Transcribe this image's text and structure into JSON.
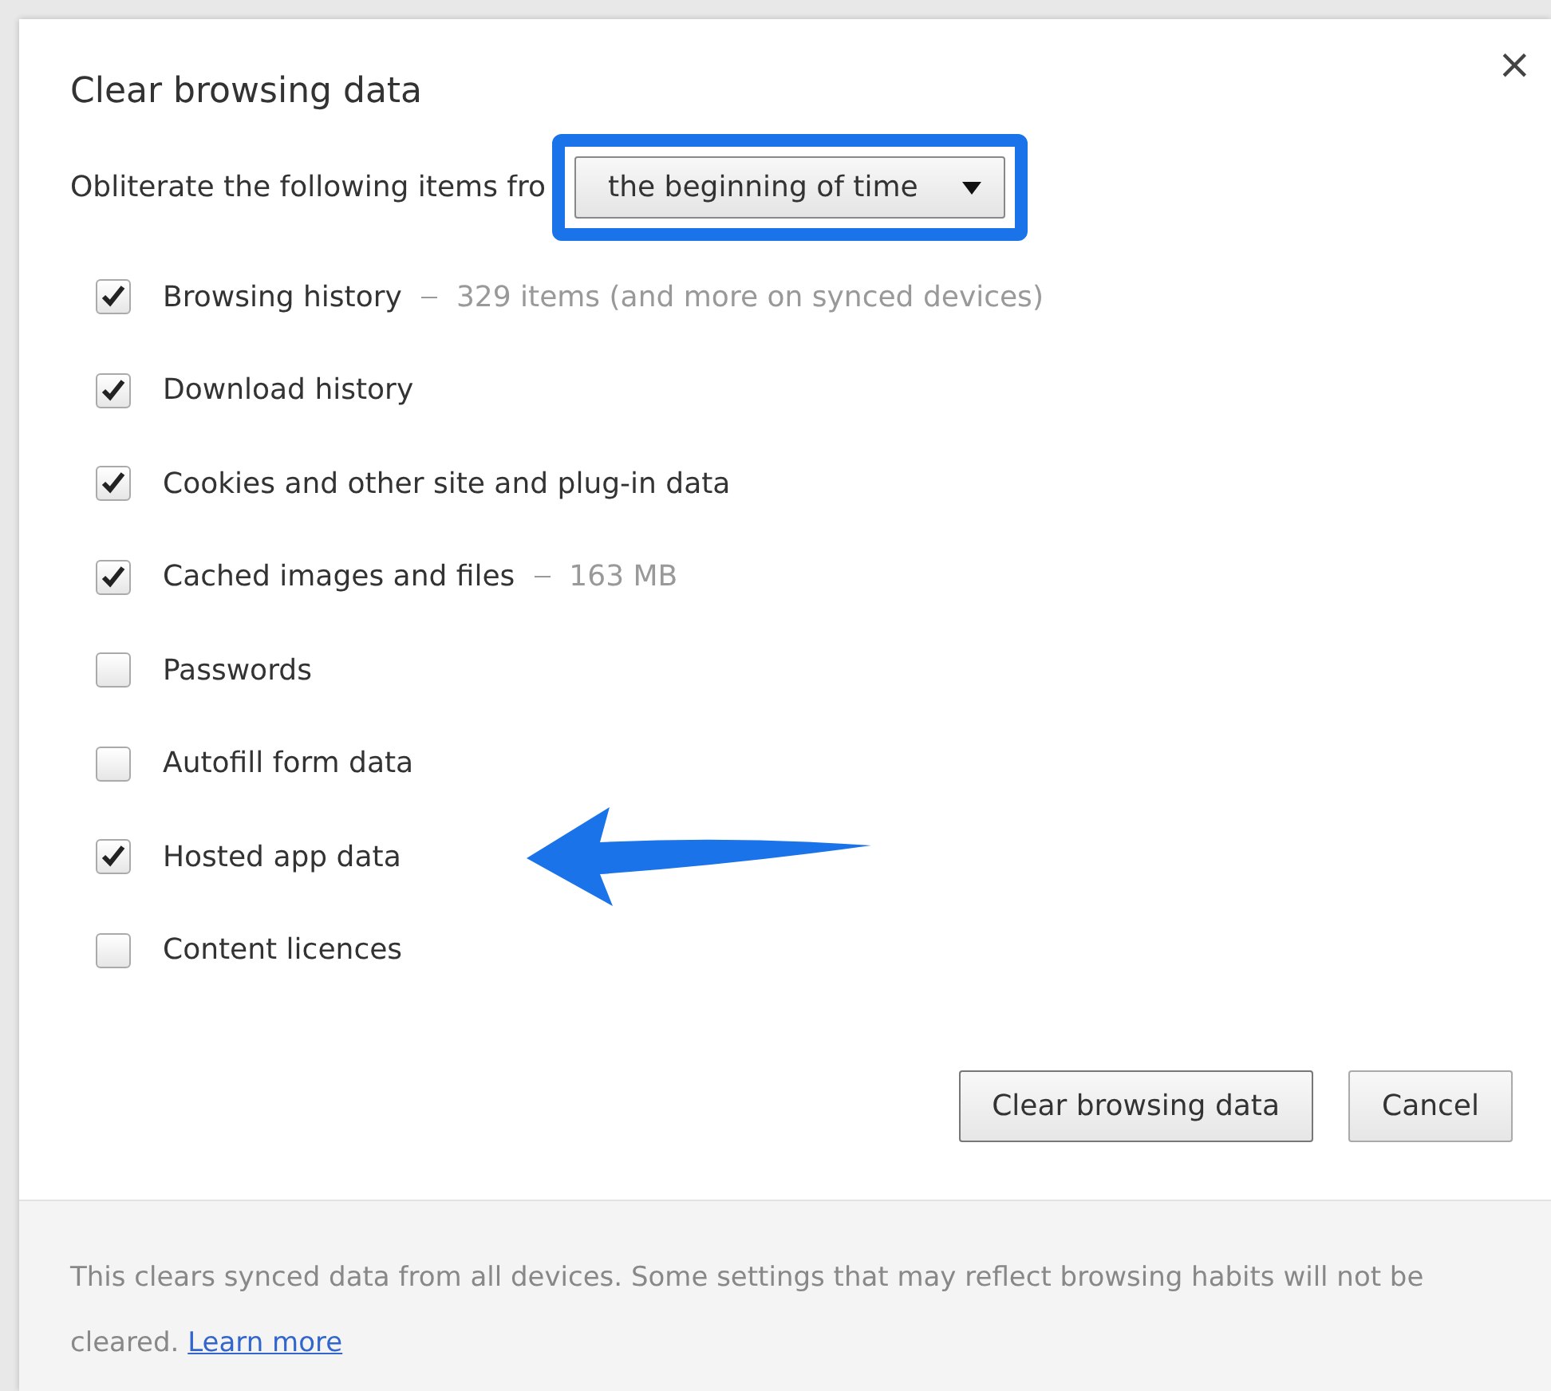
{
  "dialog": {
    "title": "Clear browsing data",
    "close": "×"
  },
  "period": {
    "label": "Obliterate the following items fro",
    "value": "the beginning of time",
    "highlighted": true
  },
  "items": [
    {
      "label": "Browsing history",
      "detail": "329 items (and more on synced devices)",
      "checked": true
    },
    {
      "label": "Download history",
      "checked": true
    },
    {
      "label": "Cookies and other site and plug-in data",
      "checked": true
    },
    {
      "label": "Cached images and files",
      "detail": "163 MB",
      "checked": true
    },
    {
      "label": "Passwords",
      "checked": false
    },
    {
      "label": "Autofill form data",
      "checked": false
    },
    {
      "label": "Hosted app data",
      "checked": true,
      "pointed": true
    },
    {
      "label": "Content licences",
      "checked": false
    }
  ],
  "buttons": [
    "Clear browsing data",
    "Cancel"
  ],
  "footer": {
    "text": "This clears synced data from all devices. Some settings that may reflect browsing habits will not be cleared.",
    "link": "Learn more"
  }
}
